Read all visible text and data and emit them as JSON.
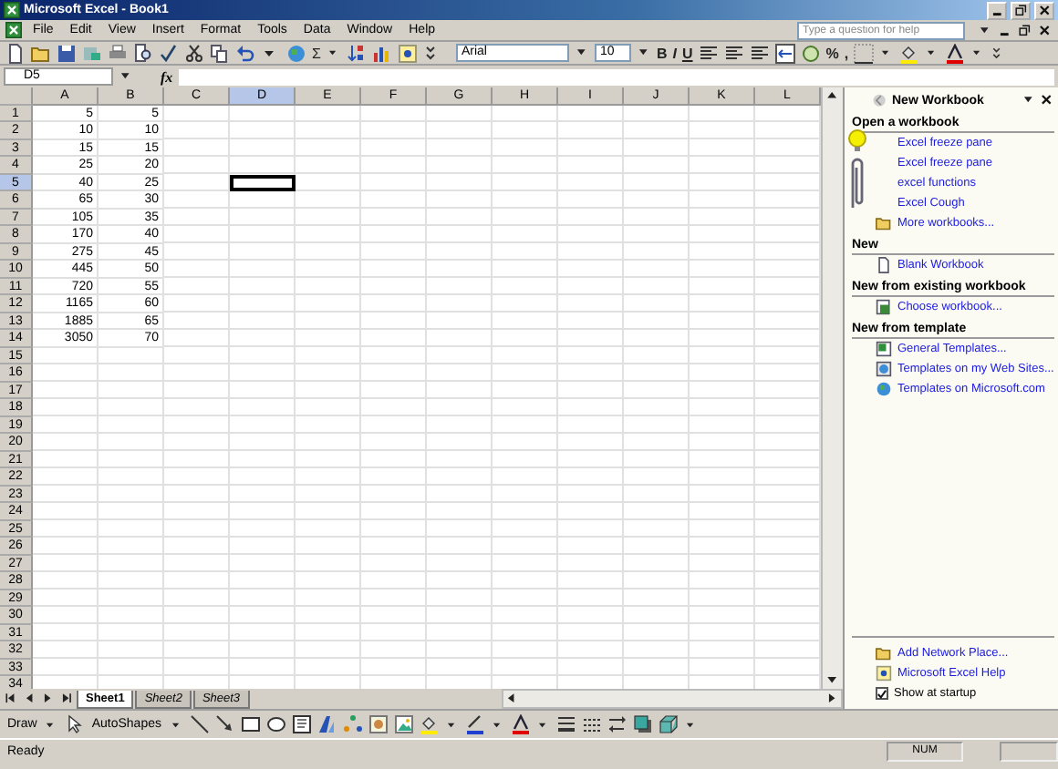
{
  "window": {
    "title": "Microsoft Excel - Book1"
  },
  "menu": [
    "File",
    "Edit",
    "View",
    "Insert",
    "Format",
    "Tools",
    "Data",
    "Window",
    "Help"
  ],
  "help_search": {
    "placeholder": "Type a question for help"
  },
  "toolbar": {
    "sum": "Σ",
    "font": "Arial",
    "font_size": "10",
    "format_buttons": [
      "B",
      "I",
      "U"
    ],
    "number_buttons": [
      "%",
      ","
    ]
  },
  "formula_bar": {
    "name_box": "D5",
    "fx": "fx"
  },
  "columns": [
    {
      "label": "A",
      "selected": false
    },
    {
      "label": "B",
      "selected": false
    },
    {
      "label": "C",
      "selected": false
    },
    {
      "label": "D",
      "selected": true
    },
    {
      "label": "E",
      "selected": false
    },
    {
      "label": "F",
      "selected": false
    },
    {
      "label": "G",
      "selected": false
    },
    {
      "label": "H",
      "selected": false
    },
    {
      "label": "I",
      "selected": false
    },
    {
      "label": "J",
      "selected": false
    },
    {
      "label": "K",
      "selected": false
    },
    {
      "label": "L",
      "selected": false
    }
  ],
  "rows": [
    {
      "label": "1",
      "selected": false,
      "cells": [
        "5",
        "5"
      ]
    },
    {
      "label": "2",
      "selected": false,
      "cells": [
        "10",
        "10"
      ]
    },
    {
      "label": "3",
      "selected": false,
      "cells": [
        "15",
        "15"
      ]
    },
    {
      "label": "4",
      "selected": false,
      "cells": [
        "25",
        "20"
      ]
    },
    {
      "label": "5",
      "selected": true,
      "cells": [
        "40",
        "25"
      ]
    },
    {
      "label": "6",
      "selected": false,
      "cells": [
        "65",
        "30"
      ]
    },
    {
      "label": "7",
      "selected": false,
      "cells": [
        "105",
        "35"
      ]
    },
    {
      "label": "8",
      "selected": false,
      "cells": [
        "170",
        "40"
      ]
    },
    {
      "label": "9",
      "selected": false,
      "cells": [
        "275",
        "45"
      ]
    },
    {
      "label": "10",
      "selected": false,
      "cells": [
        "445",
        "50"
      ]
    },
    {
      "label": "11",
      "selected": false,
      "cells": [
        "720",
        "55"
      ]
    },
    {
      "label": "12",
      "selected": false,
      "cells": [
        "1165",
        "60"
      ]
    },
    {
      "label": "13",
      "selected": false,
      "cells": [
        "1885",
        "65"
      ]
    },
    {
      "label": "14",
      "selected": false,
      "cells": [
        "3050",
        "70"
      ]
    },
    {
      "label": "15",
      "selected": false
    },
    {
      "label": "16",
      "selected": false
    },
    {
      "label": "17",
      "selected": false
    },
    {
      "label": "18",
      "selected": false
    },
    {
      "label": "19",
      "selected": false
    },
    {
      "label": "20",
      "selected": false
    },
    {
      "label": "21",
      "selected": false
    },
    {
      "label": "22",
      "selected": false
    },
    {
      "label": "23",
      "selected": false
    },
    {
      "label": "24",
      "selected": false
    },
    {
      "label": "25",
      "selected": false
    },
    {
      "label": "26",
      "selected": false
    },
    {
      "label": "27",
      "selected": false
    },
    {
      "label": "28",
      "selected": false
    },
    {
      "label": "29",
      "selected": false
    },
    {
      "label": "30",
      "selected": false
    },
    {
      "label": "31",
      "selected": false
    },
    {
      "label": "32",
      "selected": false
    },
    {
      "label": "33",
      "selected": false
    },
    {
      "label": "34",
      "selected": false
    }
  ],
  "sheet_tabs": [
    {
      "label": "Sheet1",
      "selected": true
    },
    {
      "label": "Sheet2",
      "selected": false
    },
    {
      "label": "Sheet3",
      "selected": false
    }
  ],
  "drawing_toolbar": {
    "draw": "Draw",
    "autoshapes": "AutoShapes"
  },
  "task_pane": {
    "title": "New Workbook",
    "sections": [
      {
        "heading": "Open a workbook",
        "links": [
          {
            "label": "Excel freeze pane",
            "kind": "text"
          },
          {
            "label": "Excel freeze pane",
            "kind": "text"
          },
          {
            "label": "excel functions",
            "kind": "text"
          },
          {
            "label": "Excel Cough",
            "kind": "text"
          },
          {
            "label": "More workbooks...",
            "kind": "folder"
          }
        ]
      },
      {
        "heading": "New",
        "links": [
          {
            "label": "Blank Workbook",
            "kind": "blank"
          }
        ]
      },
      {
        "heading": "New from existing workbook",
        "links": [
          {
            "label": "Choose workbook...",
            "kind": "workbook"
          }
        ]
      },
      {
        "heading": "New from template",
        "links": [
          {
            "label": "General Templates...",
            "kind": "template"
          },
          {
            "label": "Templates on my Web Sites...",
            "kind": "web"
          },
          {
            "label": "Templates on Microsoft.com",
            "kind": "globe"
          }
        ]
      }
    ],
    "footer_links": [
      {
        "label": "Add Network Place...",
        "kind": "network"
      },
      {
        "label": "Microsoft Excel Help",
        "kind": "help"
      }
    ],
    "show_at_startup": {
      "label": "Show at startup",
      "checked": true
    }
  },
  "status_bar": {
    "text": "Ready",
    "indicator": "NUM"
  }
}
